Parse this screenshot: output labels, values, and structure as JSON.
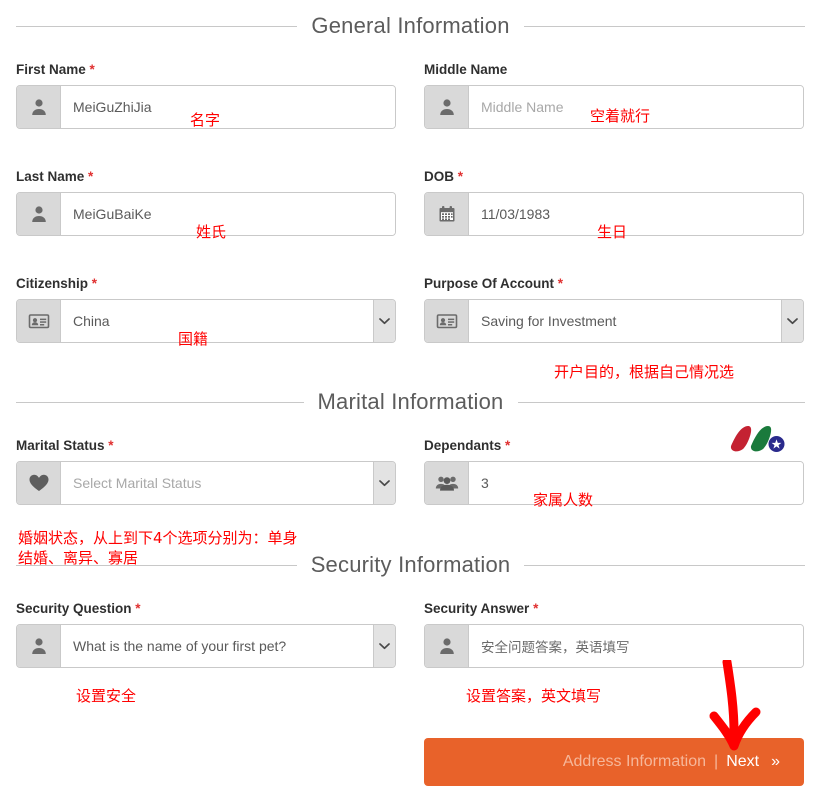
{
  "sections": {
    "general": "General Information",
    "marital": "Marital Information",
    "security": "Security Information"
  },
  "fields": {
    "first_name": {
      "label": "First Name",
      "required": "*",
      "value": "MeiGuZhiJia",
      "icon": "user-icon"
    },
    "middle_name": {
      "label": "Middle Name",
      "required": "",
      "placeholder": "Middle Name",
      "icon": "user-icon"
    },
    "last_name": {
      "label": "Last Name",
      "required": "*",
      "value": "MeiGuBaiKe",
      "icon": "user-icon"
    },
    "dob": {
      "label": "DOB",
      "required": "*",
      "value": "11/03/1983",
      "icon": "calendar-icon"
    },
    "citizenship": {
      "label": "Citizenship",
      "required": "*",
      "value": "China",
      "icon": "id-card-icon"
    },
    "purpose_of_account": {
      "label": "Purpose Of Account",
      "required": "*",
      "value": "Saving for Investment",
      "icon": "id-card-icon"
    },
    "marital_status": {
      "label": "Marital Status",
      "required": "*",
      "value": "Select Marital Status",
      "icon": "heart-icon"
    },
    "dependants": {
      "label": "Dependants",
      "required": "*",
      "value": "3",
      "icon": "users-icon"
    },
    "security_question": {
      "label": "Security Question",
      "required": "*",
      "value": "What is the name of your first pet?",
      "icon": "user-icon"
    },
    "security_answer": {
      "label": "Security Answer",
      "required": "*",
      "value": "安全问题答案，英语填写",
      "icon": "user-icon"
    }
  },
  "annotations": {
    "first_name": "名字",
    "middle_name": "空着就行",
    "last_name": "姓氏",
    "dob": "生日",
    "citizenship": "国籍",
    "purpose_of_account": "开户目的，根据自己情况选",
    "marital_status": "婚姻状态，从上到下4个选项分别为：单身\n结婚、离异、寡居",
    "dependants": "家属人数",
    "security_question": "设置安全",
    "security_answer": "设置答案，英文填写"
  },
  "footer": {
    "next_prefix": "Address Information",
    "separator": "|",
    "next_label": "Next",
    "next_chevron": "»"
  },
  "colors": {
    "accent_orange": "#e8622a",
    "annotation_red": "#ff0000",
    "required_red": "#e03030",
    "addon_grey": "#d9d9d9",
    "border_grey": "#c9c9c9",
    "logo_red": "#c42232",
    "logo_green": "#1a7a3c",
    "logo_blue": "#2a2a8c"
  }
}
